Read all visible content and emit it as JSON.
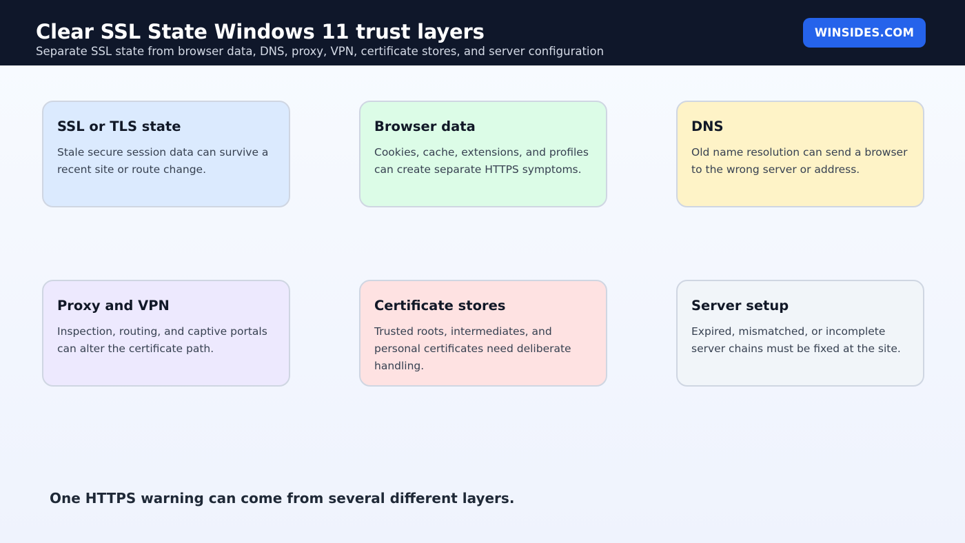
{
  "header": {
    "title": "Clear SSL State Windows 11 trust layers",
    "subtitle": "Separate SSL state from browser data, DNS, proxy, VPN, certificate stores, and server configuration",
    "brand": "WINSIDES.COM"
  },
  "cards": [
    {
      "title": "SSL or TLS state",
      "body": "Stale secure session data can survive a recent site or route change.",
      "color": "#dbeafe"
    },
    {
      "title": "Browser data",
      "body": "Cookies, cache, extensions, and profiles can create separate HTTPS symptoms.",
      "color": "#dcfce7"
    },
    {
      "title": "DNS",
      "body": "Old name resolution can send a browser to the wrong server or address.",
      "color": "#fef3c7"
    },
    {
      "title": "Proxy and VPN",
      "body": "Inspection, routing, and captive portals can alter the certificate path.",
      "color": "#ede9fe"
    },
    {
      "title": "Certificate stores",
      "body": "Trusted roots, intermediates, and personal certificates need deliberate handling.",
      "color": "#fee2e2"
    },
    {
      "title": "Server setup",
      "body": "Expired, mismatched, or incomplete server chains must be fixed at the site.",
      "color": "#f1f5f9"
    }
  ],
  "footer": {
    "note": "One HTTPS warning can come from several different layers."
  }
}
